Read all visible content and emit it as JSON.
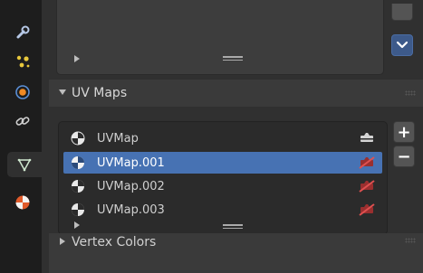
{
  "tabs": [
    {
      "icon": "wrench-icon",
      "active": false
    },
    {
      "icon": "particles-icon",
      "active": false
    },
    {
      "icon": "physics-icon",
      "active": false
    },
    {
      "icon": "constraints-icon",
      "active": false
    },
    {
      "icon": "object-data-icon",
      "active": true
    },
    {
      "icon": "material-icon",
      "active": false
    }
  ],
  "uv_maps": {
    "title": "UV Maps",
    "items": [
      {
        "name": "UVMap",
        "selected": false,
        "active_render": true
      },
      {
        "name": "UVMap.001",
        "selected": true,
        "active_render": false
      },
      {
        "name": "UVMap.002",
        "selected": false,
        "active_render": false
      },
      {
        "name": "UVMap.003",
        "selected": false,
        "active_render": false
      }
    ],
    "add_label": "+",
    "remove_label": "−"
  },
  "vertex_colors": {
    "title": "Vertex Colors"
  },
  "colors": {
    "selected_row": "#4772b3",
    "accent_button": "#3d5a8a"
  }
}
